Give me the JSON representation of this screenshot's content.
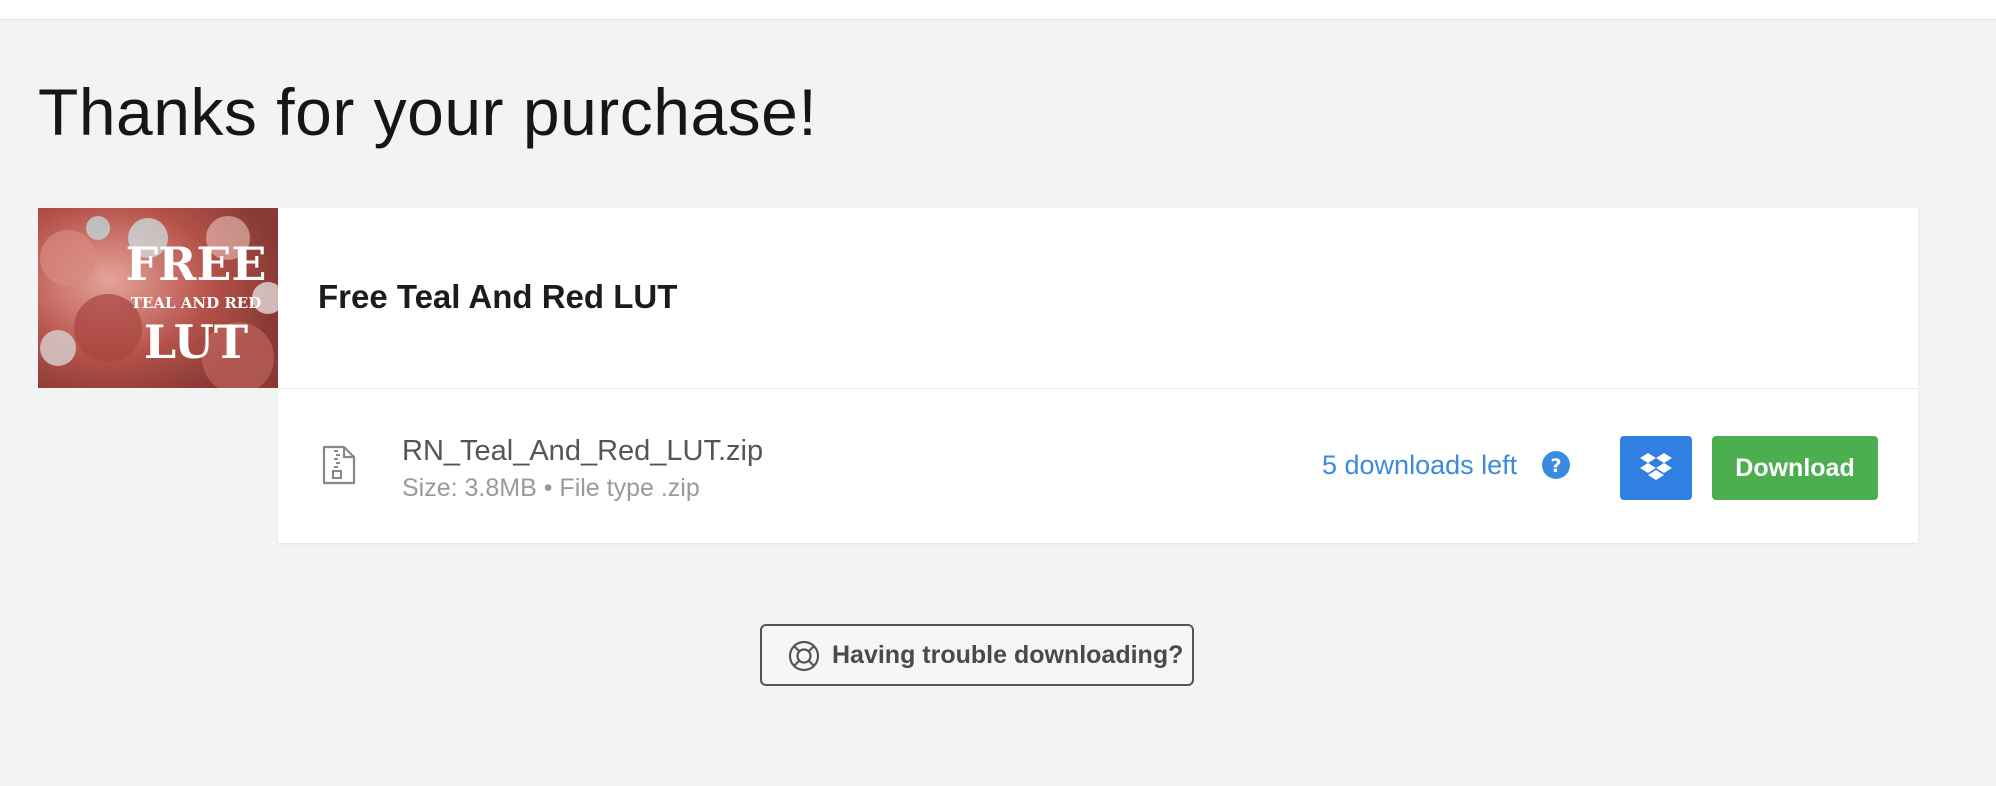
{
  "page": {
    "title": "Thanks for your purchase!"
  },
  "product": {
    "name": "Free Teal And Red LUT",
    "thumbnail": {
      "line1": "FREE",
      "line2": "TEAL AND RED",
      "line3": "LUT"
    }
  },
  "file": {
    "name": "RN_Teal_And_Red_LUT.zip",
    "meta": "Size: 3.8MB • File type .zip",
    "icon": "zip-file-icon"
  },
  "downloads": {
    "remaining_label": "5 downloads left",
    "help_icon": "question-circle-icon",
    "dropbox_icon": "dropbox-icon",
    "download_label": "Download"
  },
  "support": {
    "trouble_label": "Having trouble downloading?",
    "icon": "lifebuoy-icon"
  },
  "colors": {
    "background": "#f3f3f3",
    "card": "#ffffff",
    "link_blue": "#3a8be0",
    "dropbox_blue": "#2f80e0",
    "download_green": "#4cae4f"
  }
}
